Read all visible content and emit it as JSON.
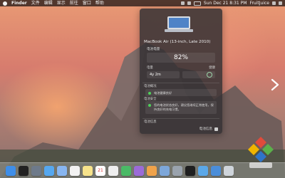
{
  "menubar": {
    "app_name": "Finder",
    "items": [
      "文件",
      "编辑",
      "显示",
      "前往",
      "窗口",
      "帮助"
    ],
    "datetime": "Sun Dec 21 8:31 PM",
    "user": "FruitJuice"
  },
  "popover": {
    "model": "MacBook Air (13-inch, Late 2010)",
    "battery_title": "电池电量",
    "battery_percent": "82%",
    "stats_left_label": "电量",
    "stats_right_label": "健康",
    "time_remaining": "4y 2m",
    "section1_title": "电池概况",
    "box1_text": "电池健康良好",
    "section2_title": "电池安全",
    "box2_text": "您的电池状态良好，建议您继续正常使用，保持良好的充电习惯。",
    "section3_title": "电池信息",
    "footer_label": "电池信息"
  },
  "dock": {
    "icons": [
      "finder-icon",
      "dashboard-icon",
      "launchpad-icon",
      "safari-icon",
      "mail-icon",
      "photos-icon",
      "notes-icon",
      "calendar-icon",
      "reminders-icon",
      "facetime-icon",
      "itunes-icon",
      "ibooks-icon",
      "app-store-icon",
      "system-preferences-icon",
      "terminal-icon",
      "folder-icon",
      "downloads-icon",
      "trash-icon"
    ],
    "calendar_day": "21"
  },
  "colors": {
    "menubar": "#161012",
    "popover_bg": "#363234",
    "accent_green": "#4fd05a"
  }
}
